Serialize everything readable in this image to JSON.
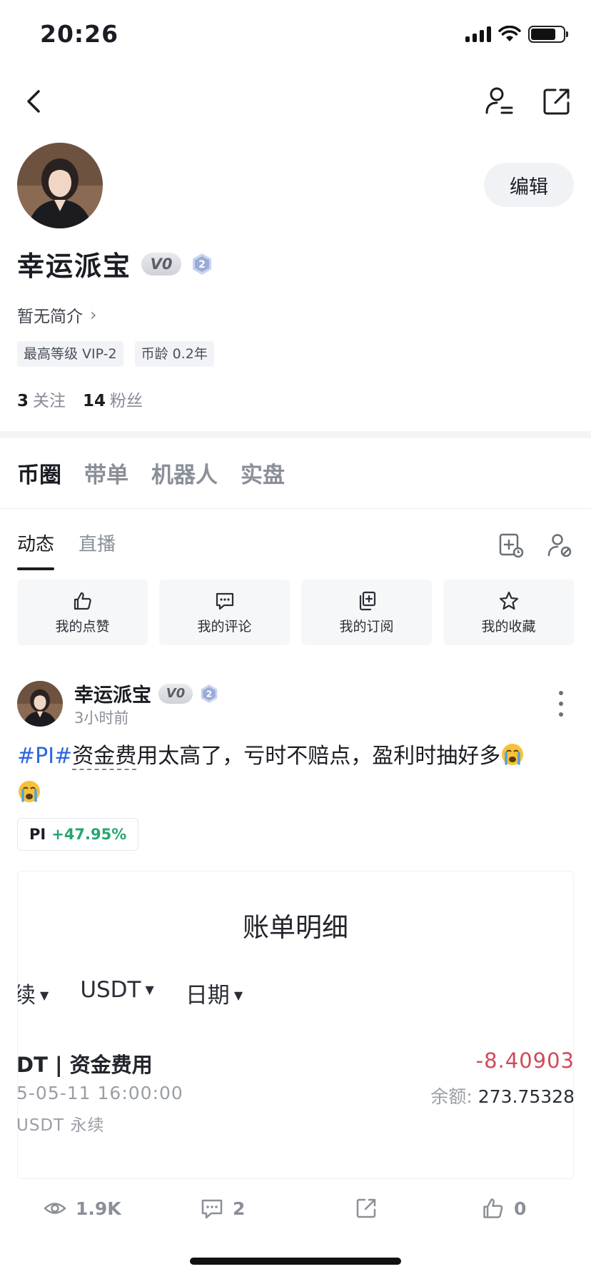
{
  "status_bar": {
    "time": "20:26",
    "icons": [
      "signal-icon",
      "wifi-icon",
      "battery-icon"
    ]
  },
  "nav": {
    "icons": [
      "back-icon",
      "user-settings-icon",
      "share-icon"
    ]
  },
  "profile": {
    "name": "幸运派宝",
    "vip_badge": "V0",
    "level_badge": "2",
    "edit_label": "编辑",
    "bio": "暂无简介",
    "tags": [
      "最高等级 VIP-2",
      "币龄 0.2年"
    ],
    "following_count": "3",
    "following_label": "关注",
    "followers_count": "14",
    "followers_label": "粉丝"
  },
  "main_tabs": [
    "币圈",
    "带单",
    "机器人",
    "实盘"
  ],
  "sub_tabs": [
    "动态",
    "直播"
  ],
  "quick_actions": [
    {
      "label": "我的点赞",
      "icon": "thumbs-up-icon"
    },
    {
      "label": "我的评论",
      "icon": "comment-icon"
    },
    {
      "label": "我的订阅",
      "icon": "subscribe-icon"
    },
    {
      "label": "我的收藏",
      "icon": "star-icon"
    }
  ],
  "post": {
    "author": "幸运派宝",
    "vip_badge": "V0",
    "level_badge": "2",
    "time": "3小时前",
    "hashtag": "#PI#",
    "linked_word": "资金费",
    "text": "用太高了，亏时不赔点，盈利时抽好多",
    "coin_symbol": "PI",
    "coin_change": "+47.95%",
    "screenshot": {
      "title": "账单明细",
      "filters": [
        "续",
        "USDT",
        "日期"
      ],
      "row_title": "DT | 资金费用",
      "amount": "-8.40903",
      "date": "5-05-11 16:00:00",
      "balance_label": "余额: ",
      "balance_value": "273.75328",
      "type": "USDT 永续"
    },
    "stats": {
      "views": "1.9K",
      "comments": "2",
      "likes": "0"
    }
  },
  "colors": {
    "hashtag": "#2d66e0",
    "positive": "#27a572",
    "negative": "#d04a5a"
  }
}
